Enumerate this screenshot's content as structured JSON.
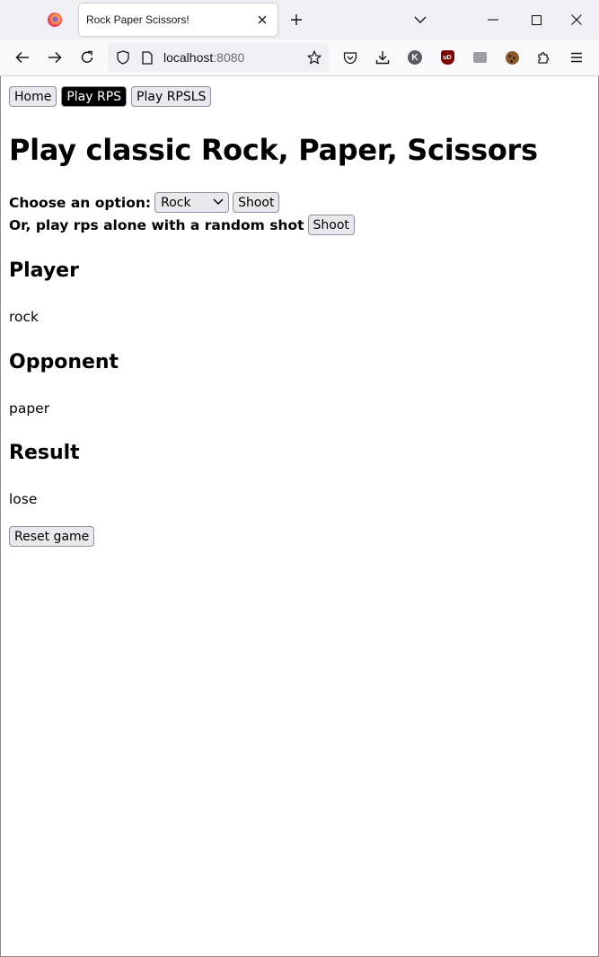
{
  "browser": {
    "tab": {
      "title": "Rock Paper Scissors!"
    },
    "url": {
      "host": "localhost",
      "port": ":8080"
    },
    "extensions": {
      "k_badge": "K",
      "ub_badge": "uD"
    }
  },
  "page": {
    "nav": {
      "home": "Home",
      "play_rps": "Play RPS",
      "play_rpsls": "Play RPSLS"
    },
    "title": "Play classic Rock, Paper, Scissors",
    "choose_label": "Choose an option:",
    "select_value": "Rock",
    "shoot_label": "Shoot",
    "random_label": "Or, play rps alone with a random shot",
    "random_shoot_label": "Shoot",
    "player_heading": "Player",
    "player_value": "rock",
    "opponent_heading": "Opponent",
    "opponent_value": "paper",
    "result_heading": "Result",
    "result_value": "lose",
    "reset_label": "Reset game"
  },
  "colors": {
    "active_nav_bg": "#000000",
    "button_bg": "#e9e9ed",
    "tabstrip_bg": "#f0f0f4"
  }
}
